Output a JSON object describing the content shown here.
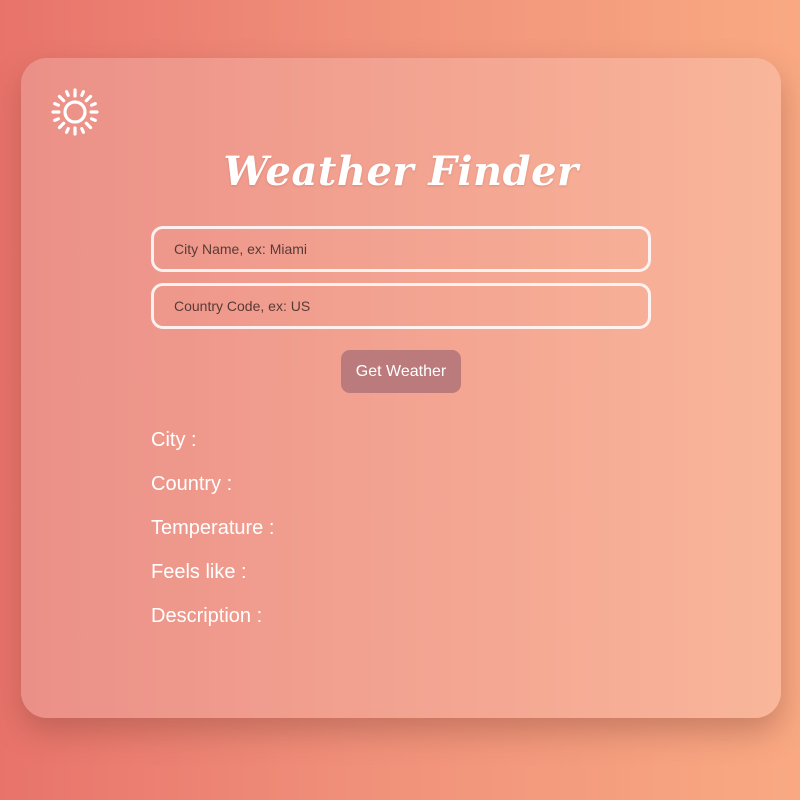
{
  "app": {
    "title": "Weather Finder"
  },
  "form": {
    "city_placeholder": "City Name, ex: Miami",
    "city_value": "",
    "country_placeholder": "Country Code, ex: US",
    "country_value": "",
    "submit_label": "Get Weather"
  },
  "results": [
    {
      "label": "City :",
      "value": ""
    },
    {
      "label": "Country :",
      "value": ""
    },
    {
      "label": "Temperature :",
      "value": ""
    },
    {
      "label": "Feels like :",
      "value": ""
    },
    {
      "label": "Description :",
      "value": ""
    }
  ],
  "icons": {
    "logo": "sun-icon"
  },
  "colors": {
    "button": "#bb7a7c",
    "text": "#ffffff"
  }
}
